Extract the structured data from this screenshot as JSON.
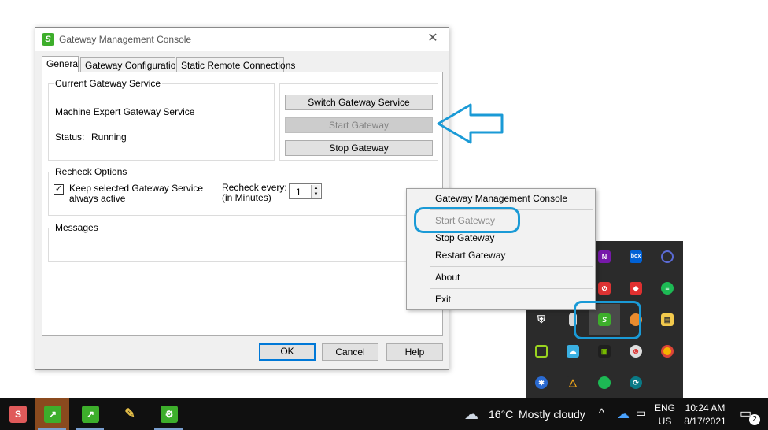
{
  "dialog": {
    "title": "Gateway Management Console",
    "close_glyph": "✕",
    "tabs": [
      "General",
      "Gateway Configuration",
      "Static Remote Connections"
    ],
    "current_service": {
      "group_label": "Current Gateway Service",
      "service_name": "Machine Expert Gateway Service",
      "status_label": "Status:",
      "status_value": "Running"
    },
    "buttons": {
      "switch": "Switch Gateway Service",
      "start": "Start Gateway",
      "stop": "Stop Gateway",
      "ok": "OK",
      "cancel": "Cancel",
      "help": "Help"
    },
    "recheck": {
      "group_label": "Recheck Options",
      "keep_active_line1": "Keep selected Gateway Service",
      "keep_active_line2": "always active",
      "keep_active_checked": true,
      "recheck_every_line1": "Recheck every:",
      "recheck_every_line2": "(in Minutes)",
      "minutes_value": "1"
    },
    "messages": {
      "group_label": "Messages"
    }
  },
  "context_menu": {
    "items": [
      "Gateway Management Console",
      "Start Gateway",
      "Stop Gateway",
      "Restart Gateway",
      "About",
      "Exit"
    ],
    "disabled_items": [
      "Start Gateway"
    ]
  },
  "tray": {
    "icons": [
      "onenote-icon",
      "box-icon",
      "cortana-icon",
      "lock-icon",
      "red-app-icon",
      "green-stack-icon",
      "security-warning-icon",
      "usb-icon",
      "gateway-icon",
      "pie-icon",
      "meter-icon",
      "snip-icon",
      "cloud-sync-icon",
      "nvidia-icon",
      "blocked-icon",
      "chrome-icon",
      "bluetooth-icon",
      "warning-drive-icon",
      "green-dot-icon",
      "refresh-icon"
    ]
  },
  "taskbar": {
    "weather_temp": "16°C",
    "weather_desc": "Mostly cloudy",
    "language": "ENG",
    "region": "US",
    "time": "10:24 AM",
    "date": "8/17/2021",
    "notification_count": "2"
  },
  "colors": {
    "accent": "#0078d7",
    "highlight": "#1a9ad6",
    "gateway_green": "#3dae2b"
  }
}
